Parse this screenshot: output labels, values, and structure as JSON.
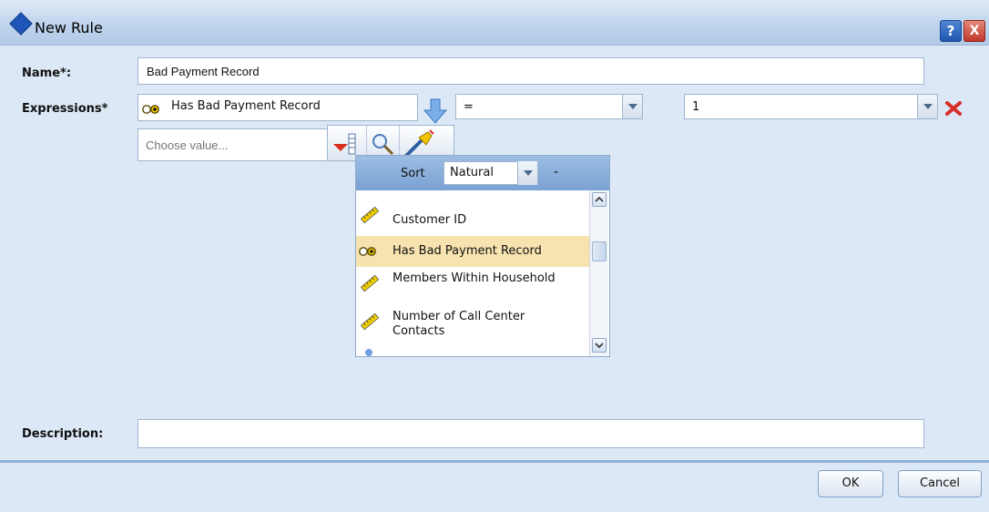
{
  "window": {
    "title": "New Rule",
    "help_label": "?",
    "close_label": "X"
  },
  "form": {
    "name_label": "Name*:",
    "name_value": "Bad Payment Record",
    "expressions_label": "Expressions*",
    "field_value": "Has Bad Payment Record",
    "operator_value": "=",
    "value_value": "1",
    "choose_value_placeholder": "Choose value...",
    "description_label": "Description:",
    "description_value": ""
  },
  "popup": {
    "sort_label": "Sort",
    "sort_value": "Natural",
    "dash_label": "-",
    "items": [
      {
        "label": "Customer ID",
        "icon": "ruler-icon",
        "selected": false
      },
      {
        "label": "Has Bad Payment Record",
        "icon": "flag-field-icon",
        "selected": true
      },
      {
        "label": "Members Within Household",
        "icon": "ruler-icon",
        "selected": false
      },
      {
        "label": "Number of Call Center Contacts",
        "icon": "ruler-icon",
        "selected": false
      }
    ]
  },
  "buttons": {
    "ok_label": "OK",
    "cancel_label": "Cancel"
  },
  "colors": {
    "background": "#dce8f6",
    "selected_row": "#f7e3b0",
    "accent_blue": "#1f55b8",
    "delete_red": "#d8302a"
  }
}
